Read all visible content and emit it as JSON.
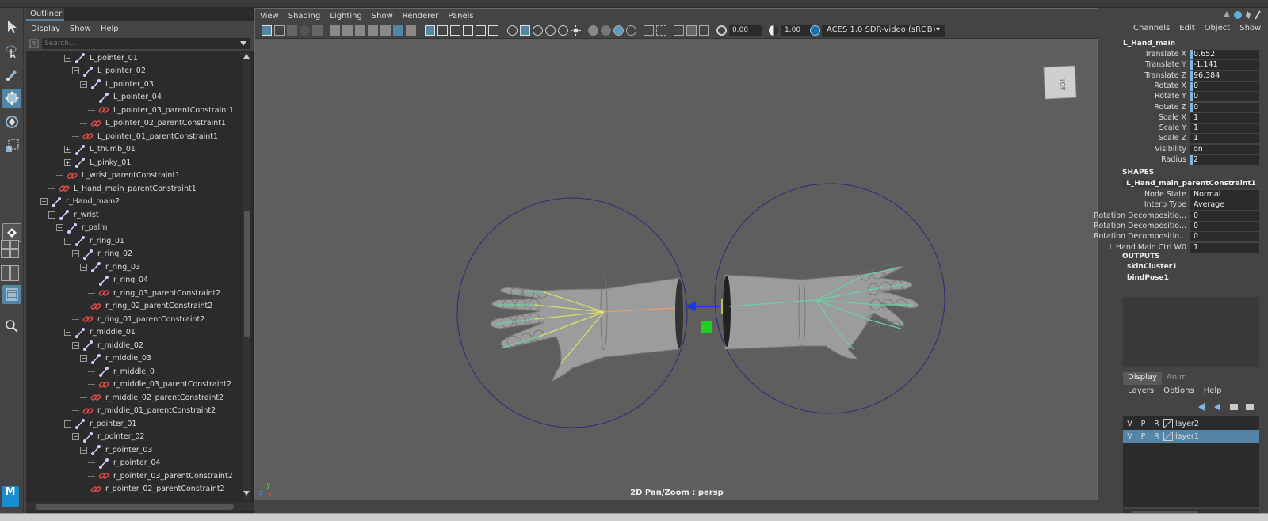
{
  "outliner": {
    "tab": "Outliner",
    "menu": [
      "Display",
      "Show",
      "Help"
    ],
    "search_placeholder": "Search...",
    "rows": [
      {
        "label": "L_pointer_01",
        "type": "joint",
        "exp": "-"
      },
      {
        "label": "L_pointer_02",
        "type": "joint",
        "exp": "-"
      },
      {
        "label": "L_pointer_03",
        "type": "joint",
        "exp": "-"
      },
      {
        "label": "L_pointer_04",
        "type": "joint",
        "exp": ""
      },
      {
        "label": "L_pointer_03_parentConstraint1",
        "type": "constraint",
        "exp": ""
      },
      {
        "label": "L_pointer_02_parentConstraint1",
        "type": "constraint",
        "exp": ""
      },
      {
        "label": "L_pointer_01_parentConstraint1",
        "type": "constraint",
        "exp": ""
      },
      {
        "label": "L_thumb_01",
        "type": "joint",
        "exp": "+"
      },
      {
        "label": "L_pinky_01",
        "type": "joint",
        "exp": "+"
      },
      {
        "label": "L_wrist_parentConstraint1",
        "type": "constraint",
        "exp": ""
      },
      {
        "label": "L_Hand_main_parentConstraint1",
        "type": "constraint",
        "exp": ""
      },
      {
        "label": "r_Hand_main2",
        "type": "joint",
        "exp": "-"
      },
      {
        "label": "r_wrist",
        "type": "joint",
        "exp": "-"
      },
      {
        "label": "r_palm",
        "type": "joint",
        "exp": "-"
      },
      {
        "label": "r_ring_01",
        "type": "joint",
        "exp": "-"
      },
      {
        "label": "r_ring_02",
        "type": "joint",
        "exp": "-"
      },
      {
        "label": "r_ring_03",
        "type": "joint",
        "exp": "-"
      },
      {
        "label": "r_ring_04",
        "type": "joint",
        "exp": ""
      },
      {
        "label": "r_ring_03_parentConstraint2",
        "type": "constraint",
        "exp": ""
      },
      {
        "label": "r_ring_02_parentConstraint2",
        "type": "constraint",
        "exp": ""
      },
      {
        "label": "r_ring_01_parentConstraint2",
        "type": "constraint",
        "exp": ""
      },
      {
        "label": "r_middle_01",
        "type": "joint",
        "exp": "-"
      },
      {
        "label": "r_middle_02",
        "type": "joint",
        "exp": "-"
      },
      {
        "label": "r_middle_03",
        "type": "joint",
        "exp": "-"
      },
      {
        "label": "r_middle_0",
        "type": "joint",
        "exp": ""
      },
      {
        "label": "r_middle_03_parentConstraint2",
        "type": "constraint",
        "exp": ""
      },
      {
        "label": "r_middle_02_parentConstraint2",
        "type": "constraint",
        "exp": ""
      },
      {
        "label": "r_middle_01_parentConstraint2",
        "type": "constraint",
        "exp": ""
      },
      {
        "label": "r_pointer_01",
        "type": "joint",
        "exp": "-"
      },
      {
        "label": "r_pointer_02",
        "type": "joint",
        "exp": "-"
      },
      {
        "label": "r_pointer_03",
        "type": "joint",
        "exp": "-"
      },
      {
        "label": "r_pointer_04",
        "type": "joint",
        "exp": ""
      },
      {
        "label": "r_pointer_03_parentConstraint2",
        "type": "constraint",
        "exp": ""
      },
      {
        "label": "r_pointer_02_parentConstraint2",
        "type": "constraint",
        "exp": ""
      }
    ]
  },
  "viewport": {
    "menu": [
      "View",
      "Shading",
      "Lighting",
      "Show",
      "Renderer",
      "Panels"
    ],
    "exposure": "0.00",
    "gamma": "1.00",
    "color_space": "ACES 1.0 SDR-video (sRGB)",
    "viewcube_label": "TOP",
    "status": "2D Pan/Zoom : persp",
    "axis_x": "x",
    "axis_y": "y",
    "axis_z": "z"
  },
  "channel_box": {
    "menu": [
      "Channels",
      "Edit",
      "Object",
      "Show"
    ],
    "object": "L_Hand_main",
    "attrs": [
      {
        "label": "Translate X",
        "value": "0.652",
        "keyed": true
      },
      {
        "label": "Translate Y",
        "value": "-1.141",
        "keyed": true
      },
      {
        "label": "Translate Z",
        "value": "96.384",
        "keyed": true
      },
      {
        "label": "Rotate X",
        "value": "0",
        "keyed": true
      },
      {
        "label": "Rotate Y",
        "value": "0",
        "keyed": true
      },
      {
        "label": "Rotate Z",
        "value": "0",
        "keyed": true
      },
      {
        "label": "Scale X",
        "value": "1",
        "keyed": false
      },
      {
        "label": "Scale Y",
        "value": "1",
        "keyed": false
      },
      {
        "label": "Scale Z",
        "value": "1",
        "keyed": false
      },
      {
        "label": "Visibility",
        "value": "on",
        "keyed": false
      },
      {
        "label": "Radius",
        "value": "2",
        "keyed": true
      }
    ],
    "shapes_title": "SHAPES",
    "shape_node": "L_Hand_main_parentConstraint1",
    "shape_attrs": [
      {
        "label": "Node State",
        "value": "Normal"
      },
      {
        "label": "Interp Type",
        "value": "Average"
      },
      {
        "label": "Rotation Decompositio...",
        "value": "0"
      },
      {
        "label": "Rotation Decompositio...",
        "value": "0"
      },
      {
        "label": "Rotation Decompositio...",
        "value": "0"
      },
      {
        "label": "L Hand Main Ctrl W0",
        "value": "1"
      }
    ],
    "outputs_title": "OUTPUTS",
    "outputs": [
      "skinCluster1",
      "bindPose1"
    ]
  },
  "layers": {
    "tabs": [
      "Display",
      "Anim"
    ],
    "menu": [
      "Layers",
      "Options",
      "Help"
    ],
    "rows": [
      {
        "v": "V",
        "p": "P",
        "r": "R",
        "name": "layer2",
        "selected": false
      },
      {
        "v": "V",
        "p": "P",
        "r": "R",
        "name": "layer1",
        "selected": true
      }
    ]
  },
  "colors": {
    "accent": "#5285a6",
    "joint": "#6ad1a0",
    "constraint_icon": "#d84a4a",
    "selected_layer": "#5285a6"
  },
  "app_logo": "M"
}
